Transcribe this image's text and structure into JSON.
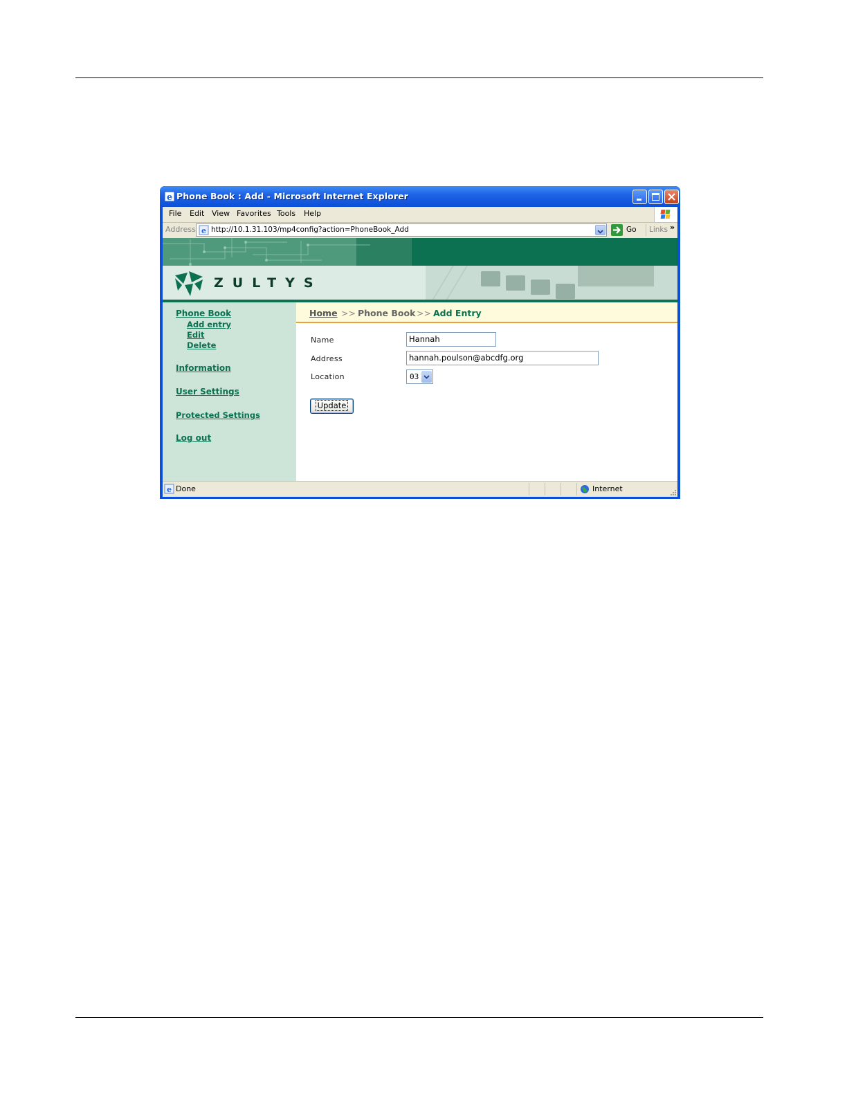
{
  "window": {
    "title": "Phone Book : Add - Microsoft Internet Explorer"
  },
  "menubar": {
    "items": [
      "File",
      "Edit",
      "View",
      "Favorites",
      "Tools",
      "Help"
    ]
  },
  "addressbar": {
    "label": "Address",
    "url": "http://10.1.31.103/mp4config?action=PhoneBook_Add",
    "go_label": "Go",
    "links_label": "Links"
  },
  "banner": {
    "logo_text": "ZULTYS",
    "colors": {
      "brand_green": "#0c7150",
      "sidebar_bg": "#cde5d9",
      "crumb_bg": "#fdfbdc",
      "crumb_underline": "#e8a038"
    }
  },
  "sidebar": {
    "items": [
      {
        "label": "Phone Book"
      },
      {
        "label": "Add entry"
      },
      {
        "label": "Edit"
      },
      {
        "label": "Delete"
      },
      {
        "label": "Information"
      },
      {
        "label": "User Settings"
      },
      {
        "label": "Protected Settings"
      },
      {
        "label": "Log out"
      }
    ]
  },
  "breadcrumb": {
    "home": "Home",
    "separator": ">>",
    "section": "Phone Book",
    "current": "Add Entry"
  },
  "form": {
    "name_label": "Name",
    "name_value": "Hannah",
    "address_label": "Address",
    "address_value": "hannah.poulson@abcdfg.org",
    "location_label": "Location",
    "location_value": "03",
    "update_label": "Update"
  },
  "statusbar": {
    "status": "Done",
    "zone": "Internet"
  }
}
